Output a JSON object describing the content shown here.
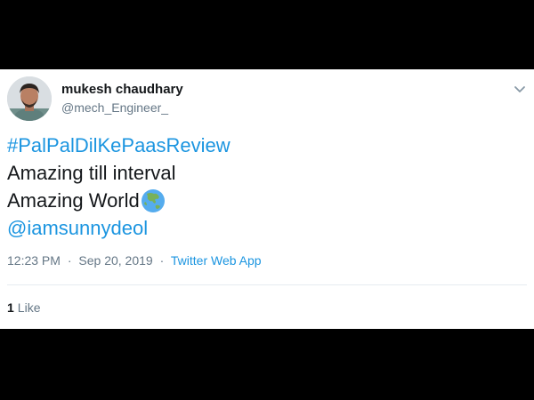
{
  "tweet": {
    "author": {
      "display_name": "mukesh chaudhary",
      "handle": "@mech_Engineer_",
      "avatar_icon": "user-avatar-photo"
    },
    "menu_icon": "chevron-down-icon",
    "lines": {
      "hashtag": "#PalPalDilKePaasReview",
      "line2": "Amazing till interval",
      "line3": "Amazing World",
      "mention": "@iamsunnydeol"
    },
    "emoji_icon": "globe-asia-icon",
    "meta": {
      "time": "12:23 PM",
      "date": "Sep 20, 2019",
      "separator": "·",
      "source": "Twitter Web App"
    },
    "likes": {
      "count": "1",
      "label": "Like"
    }
  },
  "colors": {
    "link": "#1b95e0",
    "text": "#14171a",
    "secondary": "#657786",
    "background": "#000000",
    "card": "#ffffff"
  }
}
